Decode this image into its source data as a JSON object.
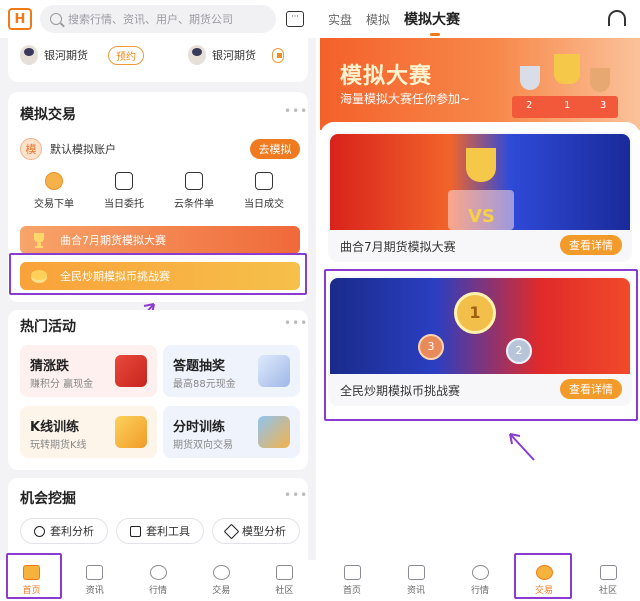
{
  "left": {
    "search_placeholder": "搜索行情、资讯、用户、期货公司",
    "brokers": [
      {
        "name": "银河期货",
        "action": "预约"
      },
      {
        "name": "银河期货"
      }
    ],
    "sim": {
      "title": "模拟交易",
      "account_icon": "模",
      "account": "默认模拟账户",
      "go": "去模拟",
      "quick": [
        "交易下单",
        "当日委托",
        "云条件单",
        "当日成交"
      ],
      "banner1": "曲合7月期货模拟大赛",
      "banner2": "全民炒期模拟币挑战赛"
    },
    "hot": {
      "title": "热门活动",
      "items": [
        {
          "t": "猜涨跌",
          "s": "赚积分 赢现金"
        },
        {
          "t": "答题抽奖",
          "s": "最高88元现金"
        },
        {
          "t": "K线训练",
          "s": "玩转期货K线"
        },
        {
          "t": "分时训练",
          "s": "期货双向交易"
        }
      ]
    },
    "opp": {
      "title": "机会挖掘",
      "chips": [
        "套利分析",
        "套利工具",
        "模型分析"
      ]
    },
    "tabs": [
      "首页",
      "资讯",
      "行情",
      "交易",
      "社区"
    ]
  },
  "right": {
    "top_tabs": [
      "实盘",
      "模拟",
      "模拟大赛"
    ],
    "hero_title": "模拟大赛",
    "hero_sub": "海量模拟大赛任你参加~",
    "podium": [
      "2",
      "1",
      "3"
    ],
    "comp1": {
      "name": "曲合7月期货模拟大赛",
      "btn": "查看详情",
      "badge": "VS"
    },
    "comp2": {
      "name": "全民炒期模拟币挑战赛",
      "btn": "查看详情",
      "medals": [
        "1",
        "2",
        "3"
      ]
    },
    "tabs": [
      "首页",
      "资讯",
      "行情",
      "交易",
      "社区"
    ]
  },
  "colors": {
    "accent": "#f07a18",
    "highlight": "#8a3bd0"
  }
}
